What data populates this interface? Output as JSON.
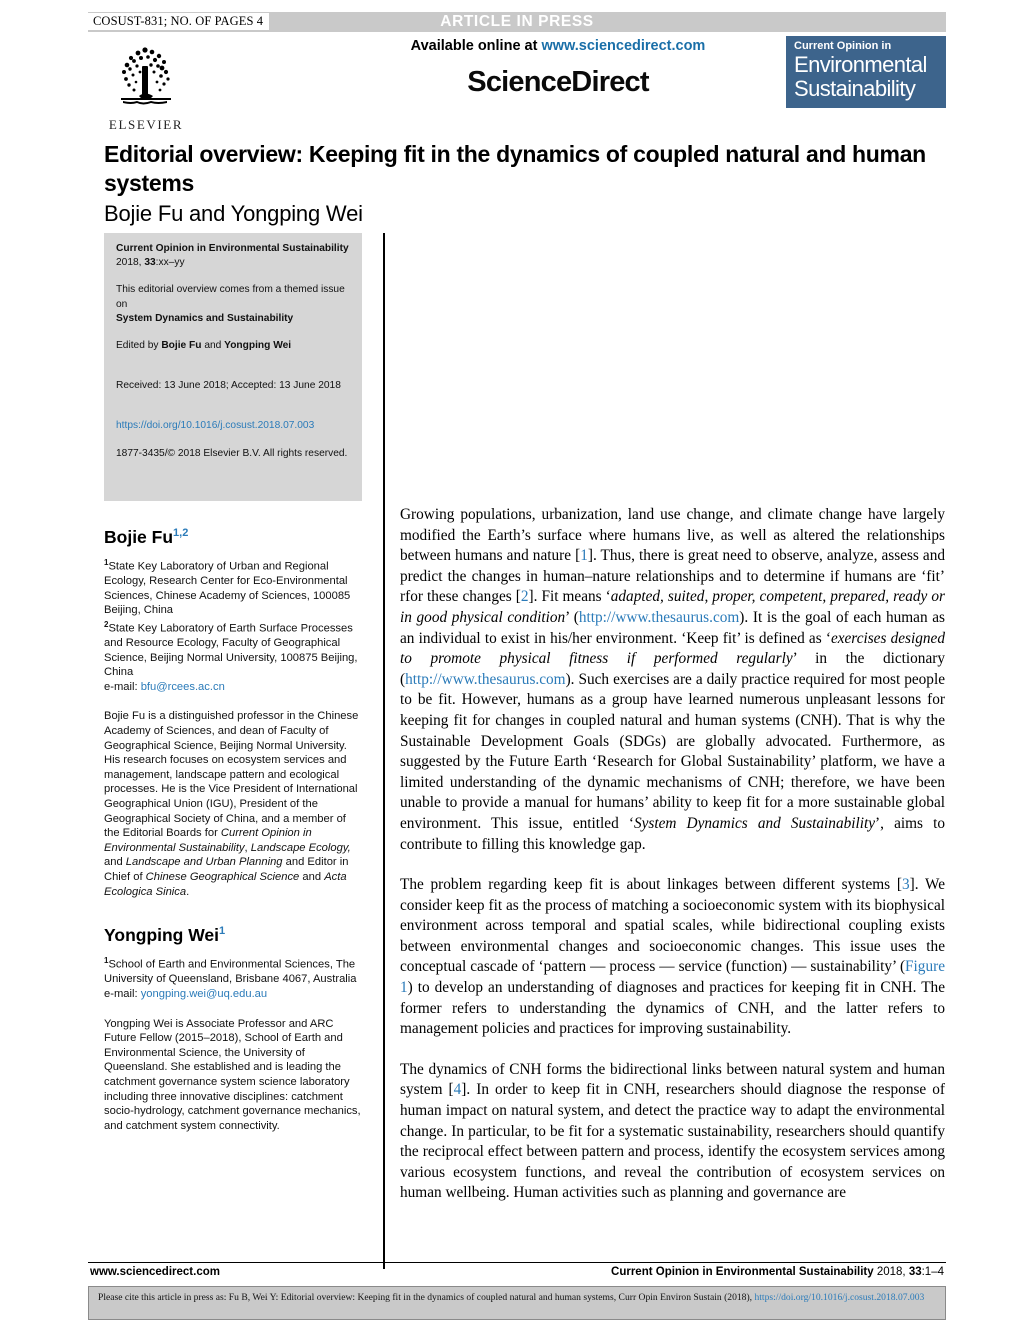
{
  "runhead": {
    "article_id": "COSUST-831; NO. OF PAGES 4",
    "press_banner": "ARTICLE IN PRESS"
  },
  "masthead": {
    "elsevier_wordmark": "ELSEVIER",
    "available_online_prefix": "Available online at ",
    "available_online_url": "www.sciencedirect.com",
    "sciencedirect": "ScienceDirect",
    "journal_badge_top": "Current Opinion in",
    "journal_badge_line1": "Environmental",
    "journal_badge_line2": "Sustainability"
  },
  "title_block": {
    "title": "Editorial overview: Keeping fit in the dynamics of coupled natural and human systems",
    "authors": "Bojie Fu and Yongping Wei"
  },
  "meta_box": {
    "journal_name": "Current Opinion in Environmental Sustainability",
    "citation_year": "2018, ",
    "citation_volume": "33",
    "citation_pages": ":xx–yy",
    "themed_intro": "This editorial overview comes from a themed issue on",
    "themed_issue": "System Dynamics and Sustainability",
    "edited_by_prefix": "Edited by ",
    "editor_one": "Bojie Fu",
    "edited_by_join": " and ",
    "editor_two": "Yongping Wei",
    "dates": "Received: 13 June 2018; Accepted: 13 June 2018",
    "doi": "https://doi.org/10.1016/j.cosust.2018.07.003",
    "copyright": "1877-3435/© 2018 Elsevier B.V. All rights reserved."
  },
  "authors": [
    {
      "name": "Bojie Fu",
      "superscript": "1,2",
      "affiliation_1_sup": "1",
      "affiliation_1": "State Key Laboratory of Urban and Regional Ecology, Research Center for Eco-Environmental Sciences, Chinese Academy of Sciences, 100085 Beijing, China",
      "affiliation_2_sup": "2",
      "affiliation_2": "State Key Laboratory of Earth Surface Processes and Resource Ecology, Faculty of Geographical Science, Beijing Normal University, 100875 Beijing, China",
      "email_label": "e-mail: ",
      "email": "bfu@rcees.ac.cn",
      "bio_part_1": "Bojie Fu is a distinguished professor in the Chinese Academy of Sciences, and dean of Faculty of Geographical Science, Beijing Normal University. His research focuses on ecosystem services and management, landscape pattern and ecological processes. He is the Vice President of International Geographical Union (IGU), President of the Geographical Society of China, and a member of the Editorial Boards for ",
      "bio_italic_1": "Current Opinion in Environmental Sustainability",
      "bio_part_2": ", ",
      "bio_italic_2": "Landscape Ecology,",
      "bio_part_3": " and ",
      "bio_italic_3": "Landscape and Urban Planning",
      "bio_part_4": " and Editor in Chief of ",
      "bio_italic_4": "Chinese Geographical Science",
      "bio_part_5": " and ",
      "bio_italic_5": "Acta Ecologica Sinica",
      "bio_part_6": "."
    },
    {
      "name": "Yongping Wei",
      "superscript": "1",
      "affiliation_1_sup": "1",
      "affiliation_1": "School of Earth and Environmental Sciences, The University of Queensland, Brisbane 4067, Australia",
      "email_label": "e-mail: ",
      "email": "yongping.wei@uq.edu.au",
      "bio_part_1": "Yongping Wei is Associate Professor and ARC Future Fellow (2015–2018), School of Earth and Environmental Science, the University of Queensland. She established and is leading the catchment governance system science laboratory including three innovative disciplines: catchment socio-hydrology, catchment governance mechanics, and catchment system connectivity."
    }
  ],
  "body": {
    "paragraph_1": {
      "t1": "Growing populations, urbanization, land use change, and climate change have largely modified the Earth’s surface where humans live, as well as altered the relationships between humans and nature [",
      "r1": "1",
      "t2": "]. Thus, there is great need to observe, analyze, assess and predict the changes in human–nature relationships and to determine if humans are ‘fit’ rfor these changes [",
      "r2": "2",
      "t3": "]. Fit means ‘",
      "i1": "adapted, suited, proper, competent, prepared, ready or in good physical condition",
      "t4": "’ (",
      "l1": "http://www.thesaurus.com",
      "t5": "). It is the goal of each human as an individual to exist in his/her environment. ‘Keep fit’ is defined as ‘",
      "i2": "exercises designed to promote physical fitness if performed regularly",
      "t6": "’ in the dictionary (",
      "l2": "http://www.thesaurus.com",
      "t7": "). Such exercises are a daily practice required for most people to be fit. However, humans as a group have learned numerous unpleasant lessons for keeping fit for changes in coupled natural and human systems (CNH). That is why the Sustainable Development Goals (SDGs) are globally advocated. Furthermore, as suggested by the Future Earth ‘Research for Global Sustainability’ platform, we have a limited understanding of the dynamic mechanisms of CNH; therefore, we have been unable to provide a manual for humans’ ability to keep fit for a more sustainable global environment. This issue, entitled ‘",
      "i3": "System Dynamics and Sustainability",
      "t8": "’, aims to contribute to filling this knowledge gap."
    },
    "paragraph_2": {
      "t1": "The problem regarding keep fit is about linkages between different systems [",
      "r1": "3",
      "t2": "]. We consider keep fit as the process of matching a socioeconomic system with its biophysical environment across temporal and spatial scales, while bidirectional coupling exists between environmental changes and socioeconomic changes. This issue uses the conceptual cascade of ‘pattern — process — service (function) — sustainability’ (",
      "l1": "Figure 1",
      "t3": ") to develop an understanding of diagnoses and practices for keeping fit in CNH. The former refers to understanding the dynamics of CNH, and the latter refers to management policies and practices for improving sustainability."
    },
    "paragraph_3": {
      "t1": "The dynamics of CNH forms the bidirectional links between natural system and human system [",
      "r1": "4",
      "t2": "]. In order to keep fit in CNH, researchers should diagnose the response of human impact on natural system, and detect the practice way to adapt the environmental change. In particular, to be fit for a systematic sustainability, researchers should quantify the reciprocal effect between pattern and process, identify the ecosystem services among various ecosystem functions, and reveal the contribution of ecosystem services on human wellbeing. Human activities such as planning and governance are"
    }
  },
  "footer": {
    "left": "www.sciencedirect.com",
    "journal_name": "Current Opinion in Environmental Sustainability",
    "year": " 2018, ",
    "volume": "33",
    "pages": ":1–4"
  },
  "cite_box": {
    "text_before_doi": "Please cite this article in press as: Fu B, Wei Y: Editorial overview: Keeping fit in the dynamics of coupled natural and human systems, Curr Opin Environ Sustain (2018), ",
    "doi": "https://doi.org/10.1016/j.cosust.2018.07.003"
  },
  "colors": {
    "banner_grey": "#c9c9c9",
    "badge_blue": "#3d648c",
    "link_blue": "#2b7bb9",
    "meta_grey": "#d6d6d6"
  }
}
